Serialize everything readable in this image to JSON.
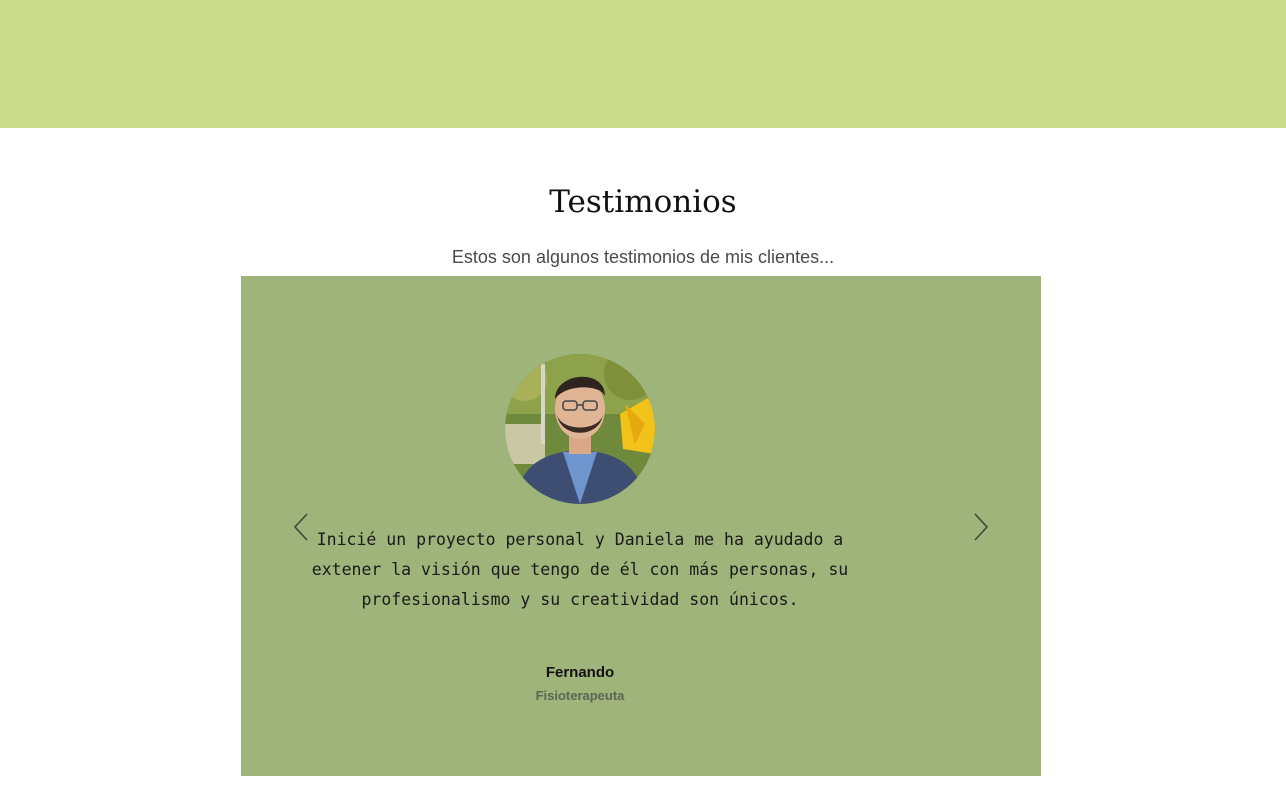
{
  "section": {
    "title": "Testimonios",
    "subtitle": "Estos son algunos testimonios de mis clientes..."
  },
  "testimonial": {
    "quote": "Inicié un proyecto personal y Daniela me ha ayudado a extener la visión que tengo de él con más personas, su profesionalismo y su creatividad son únicos.",
    "author": "Fernando",
    "role": "Fisioterapeuta"
  },
  "controls": {
    "prev_icon": "chevron-left-icon",
    "next_icon": "chevron-right-icon"
  },
  "colors": {
    "header_band": "#cadb8c",
    "carousel_bg": "#9eb47a",
    "title": "#111111",
    "subtitle": "#4a4a4a",
    "role": "#5e6552"
  }
}
